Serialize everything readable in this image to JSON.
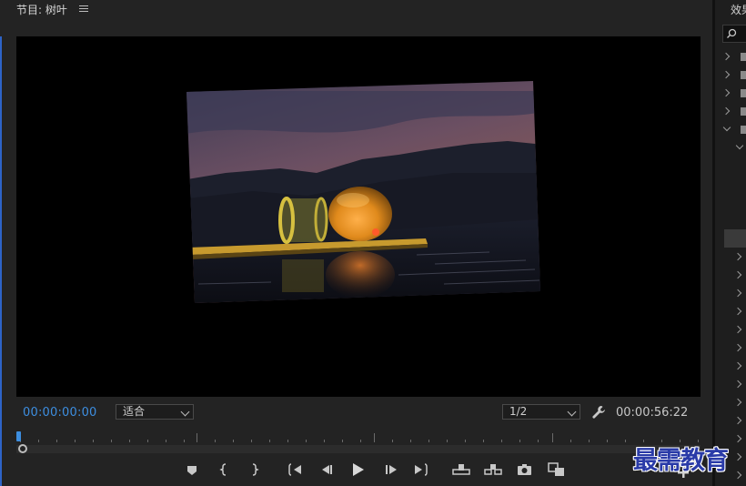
{
  "program_monitor": {
    "title": "节目: 树叶",
    "timecode_current": "00:00:00:00",
    "timecode_duration": "00:00:56:22",
    "zoom_select": {
      "value": "适合"
    },
    "resolution_select": {
      "value": "1/2"
    },
    "transport": [
      {
        "name": "add-marker-button",
        "icon": "marker-icon"
      },
      {
        "name": "mark-in-button",
        "icon": "mark-in-icon"
      },
      {
        "name": "mark-out-button",
        "icon": "mark-out-icon"
      },
      {
        "name": "go-to-in-button",
        "icon": "go-to-in-icon"
      },
      {
        "name": "step-back-button",
        "icon": "step-back-icon"
      },
      {
        "name": "play-button",
        "icon": "play-icon"
      },
      {
        "name": "step-forward-button",
        "icon": "step-forward-icon"
      },
      {
        "name": "go-to-out-button",
        "icon": "go-to-out-icon"
      },
      {
        "name": "lift-button",
        "icon": "lift-icon"
      },
      {
        "name": "extract-button",
        "icon": "extract-icon"
      },
      {
        "name": "export-frame-button",
        "icon": "camera-icon"
      },
      {
        "name": "compare-view-button",
        "icon": "compare-icon"
      }
    ]
  },
  "effects_panel": {
    "title": "效果"
  },
  "watermark": "最需教育"
}
